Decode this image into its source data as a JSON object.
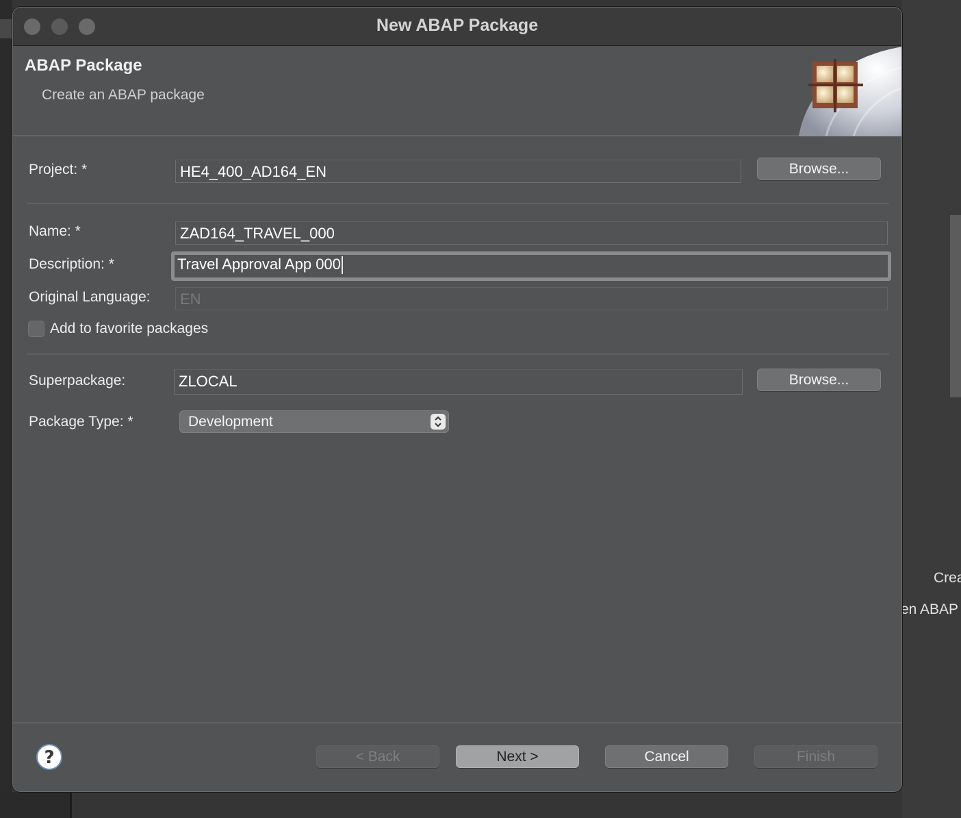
{
  "background": {
    "right_text_1": "Crea",
    "right_text_2": "en ABAP"
  },
  "dialog": {
    "title": "New ABAP Package"
  },
  "banner": {
    "title": "ABAP Package",
    "subtitle": "Create an ABAP package"
  },
  "form": {
    "project": {
      "label": "Project: *",
      "value": "HE4_400_AD164_EN",
      "browse_label": "Browse..."
    },
    "name": {
      "label": "Name: *",
      "value": "ZAD164_TRAVEL_000"
    },
    "description": {
      "label": "Description: *",
      "value": "Travel Approval App 000"
    },
    "original_language": {
      "label": "Original Language:",
      "value": "EN"
    },
    "favorite": {
      "label": "Add to favorite packages",
      "checked": false
    },
    "superpackage": {
      "label": "Superpackage:",
      "value": "ZLOCAL",
      "browse_label": "Browse..."
    },
    "package_type": {
      "label": "Package Type: *",
      "selected": "Development"
    }
  },
  "footer": {
    "back_label": "< Back",
    "next_label": "Next >",
    "cancel_label": "Cancel",
    "finish_label": "Finish",
    "help_icon": "question-circle-icon"
  }
}
